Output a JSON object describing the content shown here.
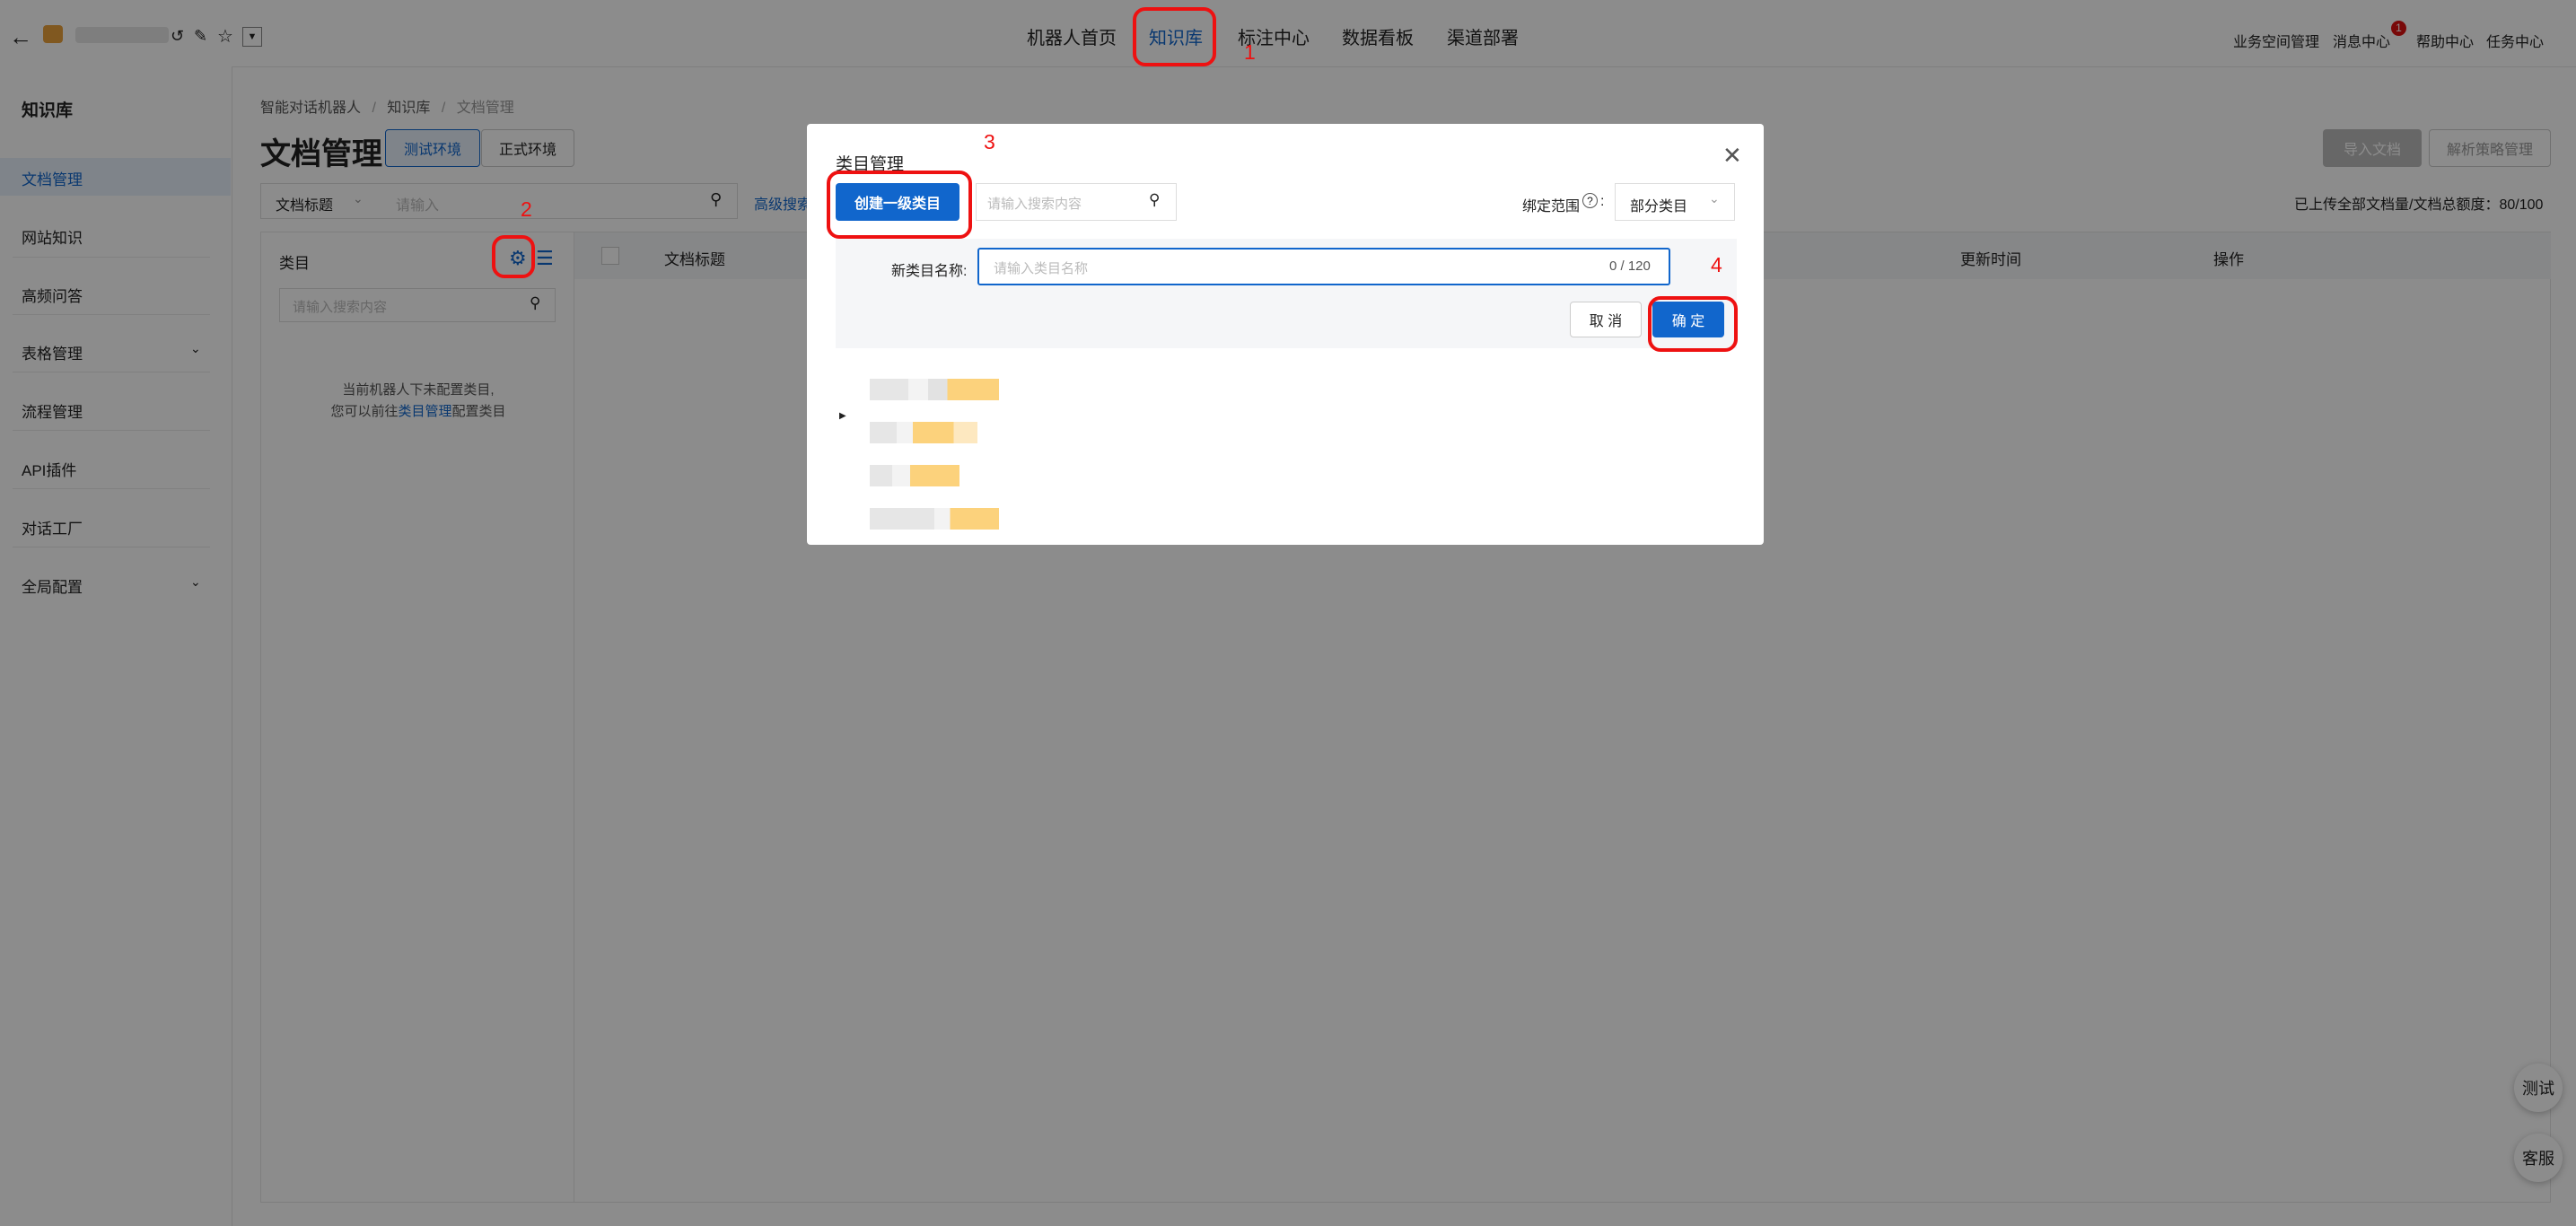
{
  "topnav": {
    "items": [
      "机器人首页",
      "知识库",
      "标注中心",
      "数据看板",
      "渠道部署"
    ],
    "right": [
      "业务空间管理",
      "消息中心",
      "帮助中心",
      "任务中心"
    ],
    "badge": "1"
  },
  "sidebar": {
    "title": "知识库",
    "items": [
      "文档管理",
      "网站知识",
      "高频问答",
      "表格管理",
      "流程管理",
      "API插件",
      "对话工厂",
      "全局配置"
    ]
  },
  "breadcrumb": [
    "智能对话机器人",
    "知识库",
    "文档管理"
  ],
  "page": {
    "title": "文档管理",
    "env_test": "测试环境",
    "env_prod": "正式环境",
    "import_btn": "导入文档",
    "parse_btn": "解析策略管理",
    "filter_select": "文档标题",
    "filter_placeholder": "请输入",
    "advanced": "高级搜索",
    "quota": "已上传全部文档量/文档总额度：80/100"
  },
  "category_panel": {
    "title": "类目",
    "search_placeholder": "请输入搜索内容",
    "empty_line1": "当前机器人下未配置类目,",
    "empty_line2_prefix": "您可以前往",
    "empty_link": "类目管理",
    "empty_line2_suffix": "配置类目"
  },
  "table": {
    "col_title": "文档标题",
    "col_updated": "更新时间",
    "col_ops": "操作"
  },
  "modal": {
    "title": "类目管理",
    "create_btn": "创建一级类目",
    "search_placeholder": "请输入搜索内容",
    "bind_label": "绑定范围",
    "bind_value": "部分类目",
    "new_name_label": "新类目名称:",
    "new_name_placeholder": "请输入类目名称",
    "counter": "0 / 120",
    "cancel": "取 消",
    "confirm": "确 定"
  },
  "annotations": [
    "1",
    "2",
    "3",
    "4"
  ],
  "fabs": [
    "测试",
    "客服"
  ],
  "colors": {
    "primary": "#1166cc",
    "annotation": "#ee1111",
    "overlay": "rgba(0,0,0,0.45)"
  }
}
